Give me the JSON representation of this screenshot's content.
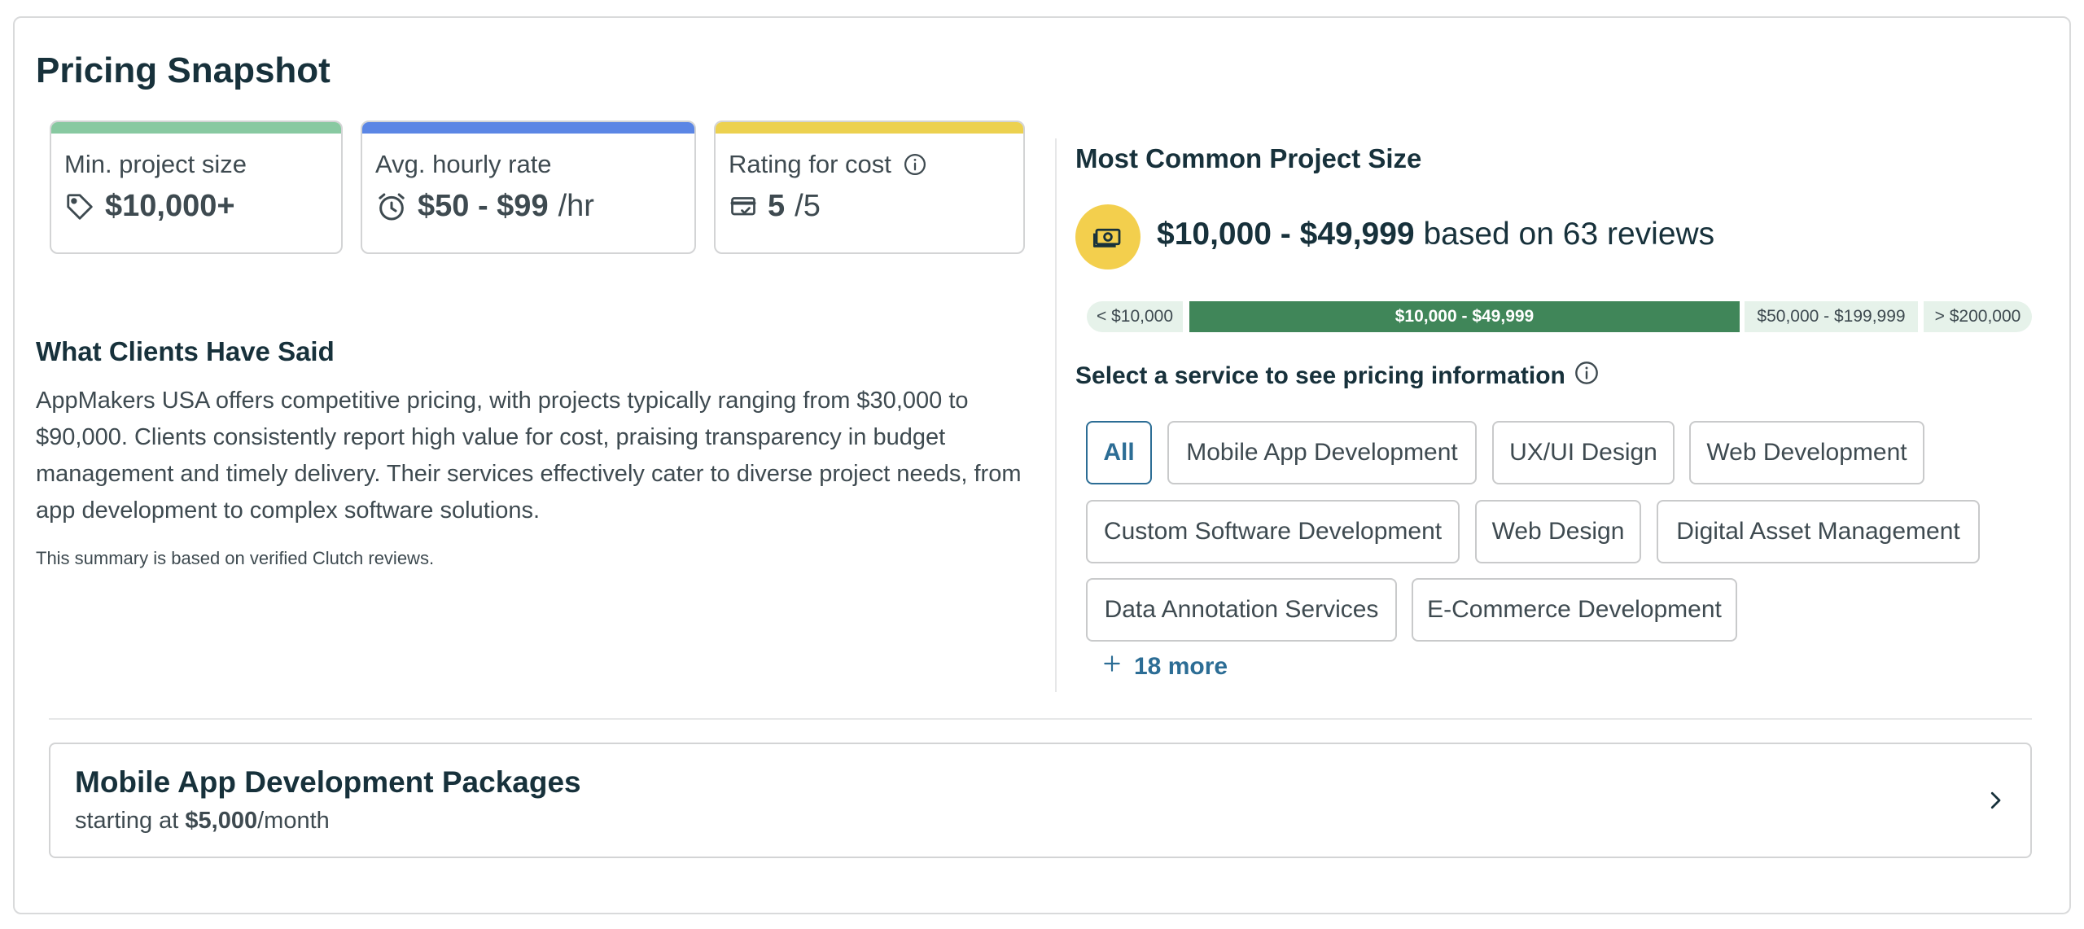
{
  "title": "Pricing Snapshot",
  "stats": [
    {
      "label": "Min. project size",
      "value": "$10,000+",
      "unit": "",
      "icon": "tag-icon",
      "color": "#88c9a1"
    },
    {
      "label": "Avg. hourly rate",
      "value": "$50 - $99",
      "unit": "/hr",
      "icon": "clock-icon",
      "color": "#5b86e5"
    },
    {
      "label": "Rating for cost",
      "value": "5",
      "unit": "/5",
      "icon": "card-check-icon",
      "color": "#ecd14f"
    }
  ],
  "clients": {
    "heading": "What Clients Have Said",
    "summary": "AppMakers USA offers competitive pricing, with projects typically ranging from $30,000 to $90,000. Clients consistently report high value for cost, praising transparency in budget management and timely delivery. Their services effectively cater to diverse project needs, from app development to complex software solutions.",
    "note": "This summary is based on verified Clutch reviews."
  },
  "common_size": {
    "heading": "Most Common Project Size",
    "value": "$10,000 - $49,999",
    "suffix": " based on 63 reviews",
    "ranges": [
      "< $10,000",
      "$10,000 - $49,999",
      "$50,000 - $199,999",
      "> $200,000"
    ]
  },
  "services": {
    "label": "Select a service to see pricing information",
    "chips": [
      "All",
      "Mobile App Development",
      "UX/UI Design",
      "Web Development",
      "Custom Software Development",
      "Web Design",
      "Digital Asset Management",
      "Data Annotation Services",
      "E-Commerce Development"
    ],
    "more": "18 more"
  },
  "package": {
    "title": "Mobile App Development Packages",
    "prefix": "starting at ",
    "price": "$5,000",
    "suffix": "/month"
  }
}
